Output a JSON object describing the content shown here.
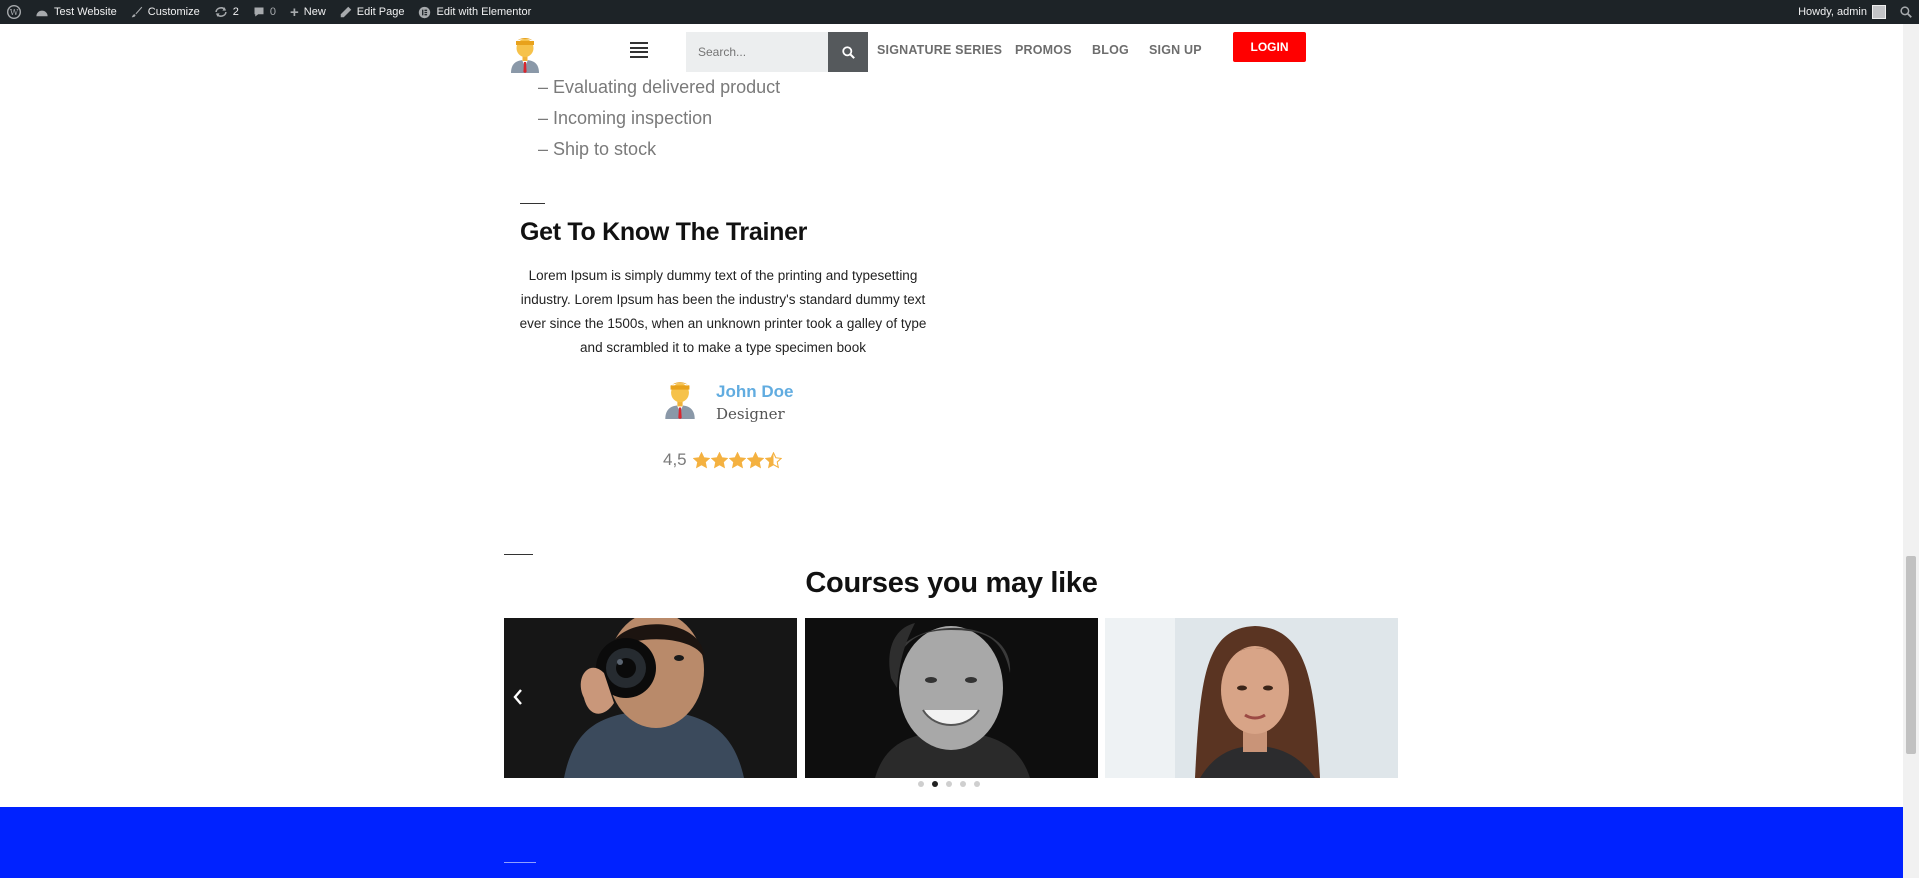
{
  "admin_bar": {
    "site_name": "Test Website",
    "customize": "Customize",
    "updates_count": "2",
    "comments_count": "0",
    "new": "New",
    "edit_page": "Edit Page",
    "edit_elementor": "Edit with Elementor",
    "howdy": "Howdy, admin"
  },
  "header": {
    "search_placeholder": "Search...",
    "nav": [
      "SIGNATURE SERIES",
      "PROMOS",
      "BLOG",
      "SIGN UP"
    ],
    "login": "LOGIN"
  },
  "list_items": [
    "– Evaluating delivered product",
    "– Incoming inspection",
    "– Ship to stock"
  ],
  "trainer": {
    "heading": "Get To Know The Trainer",
    "bio": "Lorem Ipsum is simply dummy text of the printing and typesetting industry. Lorem Ipsum has been the industry's standard dummy text ever since the 1500s, when an unknown printer took a galley of type and scrambled it to make a type specimen book",
    "name": "John Doe",
    "role": "Designer",
    "rating_label": "4,5",
    "rating_value": 4.5,
    "rating_max": 5
  },
  "courses": {
    "heading": "Courses you may like",
    "slide_count": 5,
    "active_slide": 1
  },
  "colors": {
    "accent_red": "#ff0000",
    "footer_blue": "#0022ff",
    "name_blue": "#61ace0",
    "star_gold": "#f4b140"
  }
}
